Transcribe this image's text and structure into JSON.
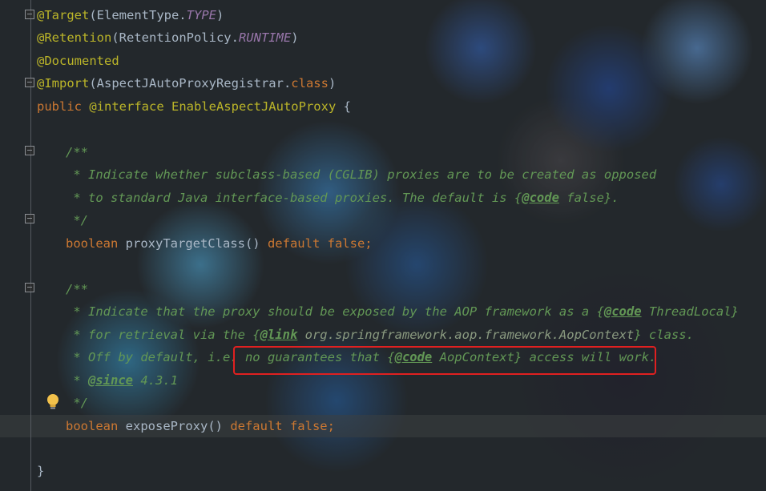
{
  "code": {
    "lines": {
      "l1_ann": "@Target",
      "l1_rest_a": "(ElementType.",
      "l1_const": "TYPE",
      "l1_rest_b": ")",
      "l2_ann": "@Retention",
      "l2_rest_a": "(RetentionPolicy.",
      "l2_const": "RUNTIME",
      "l2_rest_b": ")",
      "l3_ann": "@Documented",
      "l4_ann": "@Import",
      "l4_rest_a": "(AspectJAutoProxyRegistrar.",
      "l4_kw": "class",
      "l4_rest_b": ")",
      "l5_kw1": "public",
      "l5_ann": " @interface ",
      "l5_name": "EnableAspectJAutoProxy",
      "l5_brace": " {",
      "l6_doc": "/**",
      "l7_doc": " * Indicate whether subclass-based (CGLIB) proxies are to be created as opposed",
      "l8_doc_a": " * to standard Java interface-based proxies. The default is {",
      "l8_tag": "@code",
      "l8_doc_b": " false}.",
      "l9_doc": " */",
      "l10_kw": "boolean",
      "l10_name": " proxyTargetClass",
      "l10_parens": "() ",
      "l10_kw2": "default false",
      "l10_semi": ";",
      "l11_doc": "/**",
      "l12_doc_a": " * Indicate that the proxy should be exposed by the AOP framework as a {",
      "l12_tag": "@code",
      "l12_doc_b": " ThreadLocal}",
      "l13_doc_a": " * for retrieval via the {",
      "l13_tag": "@link",
      "l13_ref": " org.springframework.aop.framework.AopContext",
      "l13_doc_b": "} class.",
      "l14_doc_a": " * Off by default, i.e. no guarantees that {",
      "l14_tag": "@code",
      "l14_doc_b": " AopContext} access will work.",
      "l15_star": " * ",
      "l15_tag": "@since",
      "l15_ver": " 4.3.1",
      "l16_doc": " */",
      "l17_kw": "boolean",
      "l17_name": " exposeProxy",
      "l17_parens": "() ",
      "l17_kw2": "default false",
      "l17_semi": ";",
      "l18_brace": "}"
    }
  },
  "icons": {
    "gutter_fold": "fold-marker-icon",
    "intention": "lightbulb-icon"
  },
  "colors": {
    "annotation": "#bbb529",
    "keyword": "#cc7832",
    "doc_comment": "#629755",
    "constant": "#9876aa",
    "highlight_box": "#e02020"
  }
}
